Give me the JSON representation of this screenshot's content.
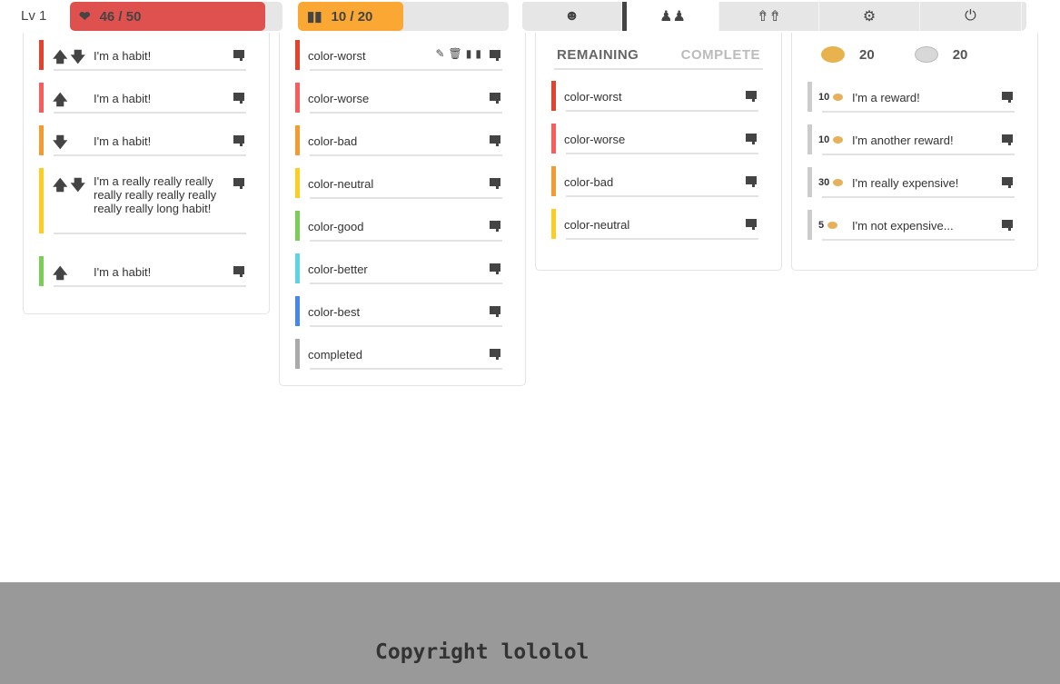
{
  "header": {
    "level": "Lv 1",
    "hp": {
      "label": "46 / 50",
      "value": 46,
      "max": 50,
      "color": "#df514e",
      "icon": "heart-icon"
    },
    "xp": {
      "label": "10 / 20",
      "value": 10,
      "max": 20,
      "color": "#fba733",
      "icon": "bars-icon"
    },
    "nav": [
      {
        "icon": "avatar-icon",
        "glyph": "☻",
        "active": false
      },
      {
        "icon": "party-icon",
        "glyph": "♟♟",
        "active": true
      },
      {
        "icon": "market-icon",
        "glyph": "⇮⇮",
        "active": false
      },
      {
        "icon": "settings-icon",
        "glyph": "⚙",
        "active": false
      },
      {
        "icon": "logout-icon",
        "glyph": "⏻",
        "active": false
      }
    ]
  },
  "habits": [
    {
      "text": "I'm a habit!",
      "arrows": "🡅🡇",
      "color": "#e8402a"
    },
    {
      "text": "I'm a habit!",
      "arrows": "🡅",
      "color": "#ff5a5a"
    },
    {
      "text": "I'm a habit!",
      "arrows": "🡇",
      "color": "#f7992e"
    },
    {
      "text": "I'm a really really really really really really really really really long habit!",
      "arrows": "🡅🡇",
      "color": "#ffcc22",
      "tall": true
    },
    {
      "text": "I'm a habit!",
      "arrows": "🡅",
      "color": "#77d055"
    }
  ],
  "dailies": [
    {
      "text": "color-worst",
      "color": "#e8402a",
      "tools": "✎🗑▮▮"
    },
    {
      "text": "color-worse",
      "color": "#ff5a5a"
    },
    {
      "text": "color-bad",
      "color": "#f7992e"
    },
    {
      "text": "color-neutral",
      "color": "#ffcc22"
    },
    {
      "text": "color-good",
      "color": "#77d055"
    },
    {
      "text": "color-better",
      "color": "#5bd3e8"
    },
    {
      "text": "color-best",
      "color": "#4488ee"
    },
    {
      "text": "completed",
      "color": "#aaaaaa"
    }
  ],
  "todos": {
    "tabs": [
      "REMAINING",
      "COMPLETE"
    ],
    "items": [
      {
        "text": "color-worst",
        "color": "#e8402a"
      },
      {
        "text": "color-worse",
        "color": "#ff5a5a"
      },
      {
        "text": "color-bad",
        "color": "#f7992e"
      },
      {
        "text": "color-neutral",
        "color": "#ffcc22"
      }
    ]
  },
  "rewards": {
    "gold": "20",
    "silver": "20",
    "items": [
      {
        "price": "10",
        "text": "I'm a reward!"
      },
      {
        "price": "10",
        "text": "I'm another reward!"
      },
      {
        "price": "30",
        "text": "I'm really expensive!"
      },
      {
        "price": "5",
        "text": "I'm not expensive..."
      }
    ]
  },
  "footer": {
    "copyright": "Copyright lololol"
  }
}
